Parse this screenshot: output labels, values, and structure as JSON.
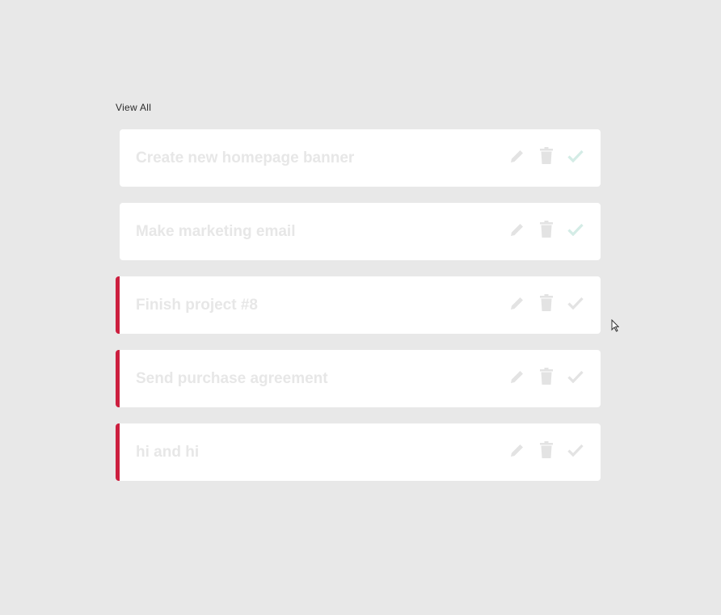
{
  "header": {
    "view_all_label": "View All"
  },
  "colors": {
    "background": "#e8e8e8",
    "card": "#ffffff",
    "urgent_accent": "#cc1f3f",
    "muted_text": "#e7e7e7",
    "muted_icon": "#e3e3e3",
    "check_done": "#d4ece6"
  },
  "tasks": [
    {
      "title": "Create new homepage banner",
      "urgent": false,
      "completed": true,
      "icons": [
        "pencil-icon",
        "trash-icon",
        "check-icon"
      ]
    },
    {
      "title": "Make marketing email",
      "urgent": false,
      "completed": true,
      "icons": [
        "pencil-icon",
        "trash-icon",
        "check-icon"
      ]
    },
    {
      "title": "Finish project #8",
      "urgent": true,
      "completed": false,
      "icons": [
        "pencil-icon",
        "trash-icon",
        "check-icon"
      ]
    },
    {
      "title": "Send purchase agreement",
      "urgent": true,
      "completed": false,
      "icons": [
        "pencil-icon",
        "trash-icon",
        "check-icon"
      ]
    },
    {
      "title": "hi and hi",
      "urgent": true,
      "completed": false,
      "icons": [
        "pencil-icon",
        "trash-icon",
        "check-icon"
      ]
    }
  ]
}
